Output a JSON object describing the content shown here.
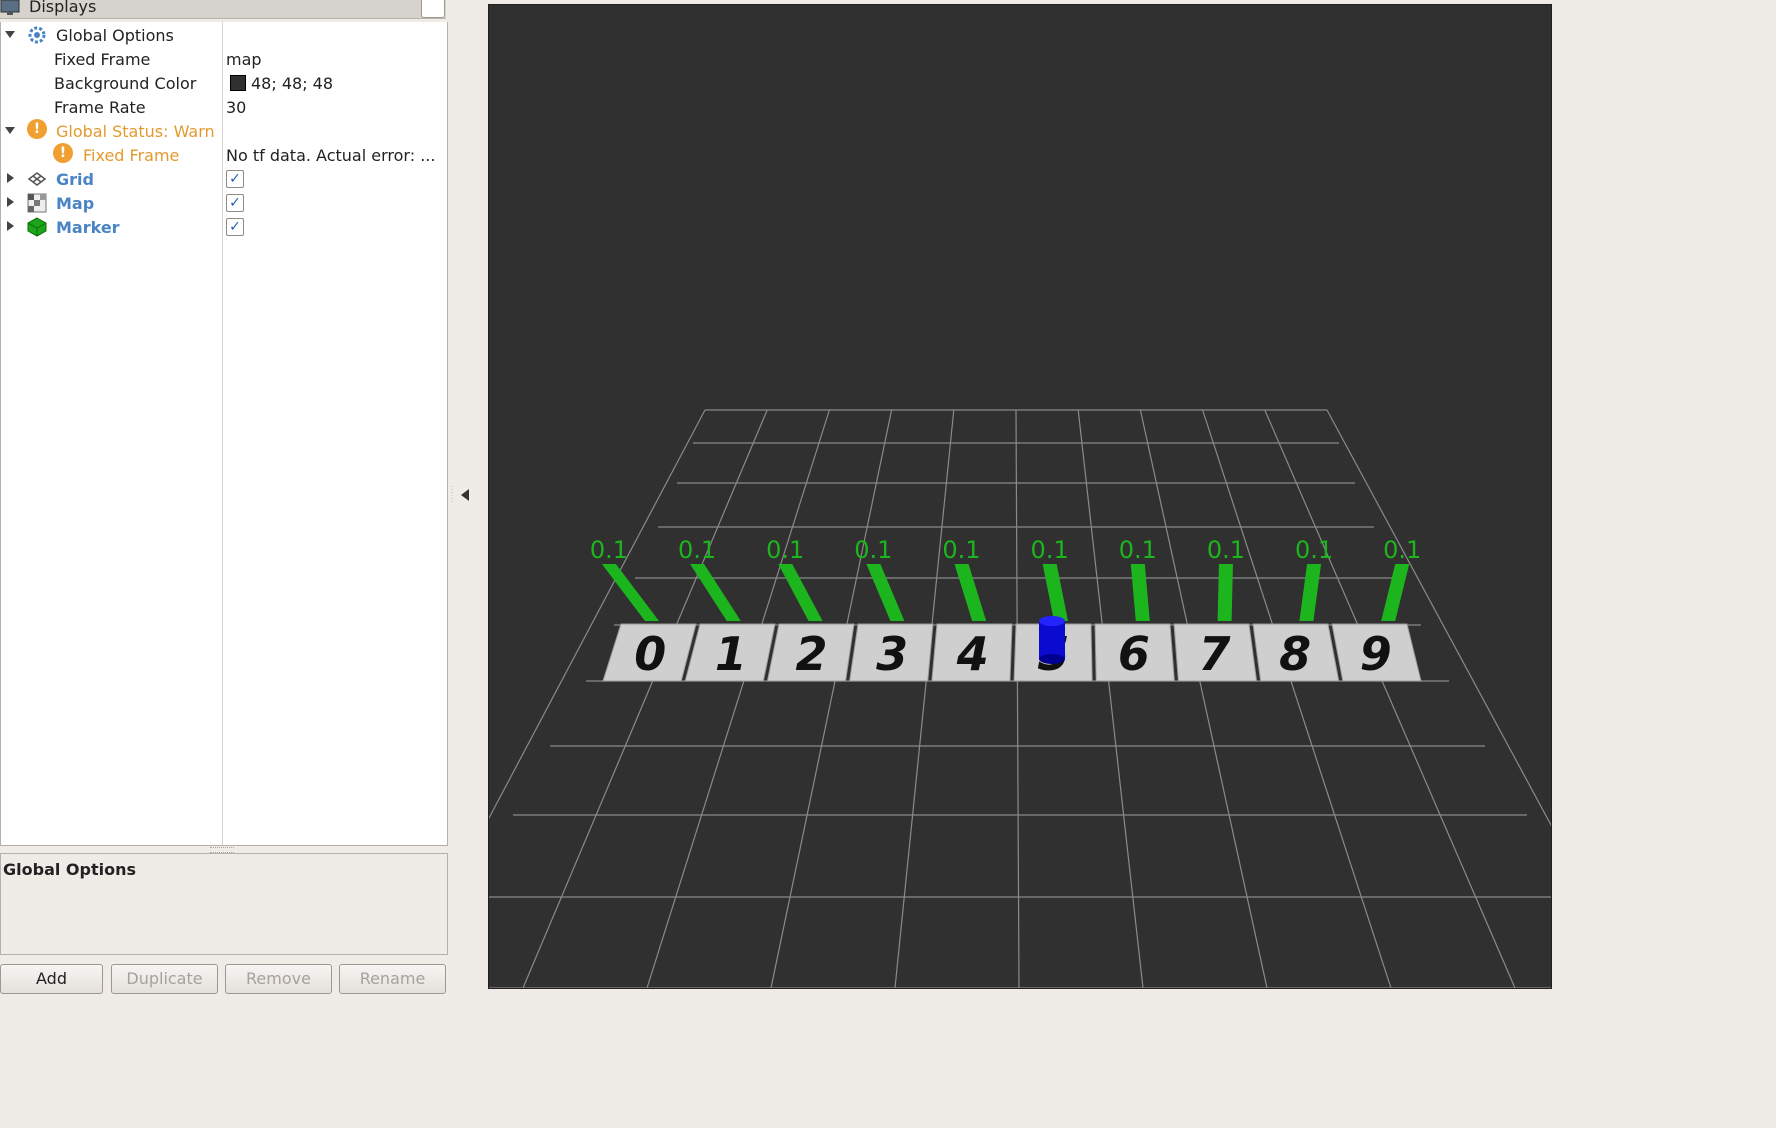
{
  "panel": {
    "title": "Displays",
    "tree": {
      "global_options": "Global Options",
      "fixed_frame_label": "Fixed Frame",
      "fixed_frame_value": "map",
      "background_color_label": "Background Color",
      "background_color_value": "48; 48; 48",
      "frame_rate_label": "Frame Rate",
      "frame_rate_value": "30",
      "global_status": "Global Status: Warn",
      "status_fixed_frame_label": "Fixed Frame",
      "status_fixed_frame_value": "No tf data.  Actual error: ...",
      "grid": "Grid",
      "map": "Map",
      "marker": "Marker"
    },
    "description_title": "Global Options",
    "buttons": {
      "add": "Add",
      "duplicate": "Duplicate",
      "remove": "Remove",
      "rename": "Rename"
    }
  },
  "view": {
    "background": "#303030",
    "tile_digits": [
      "0",
      "1",
      "2",
      "3",
      "4",
      "5",
      "6",
      "7",
      "8",
      "9"
    ],
    "marker_labels": [
      "0.1",
      "0.1",
      "0.1",
      "0.1",
      "0.1",
      "0.1",
      "0.1",
      "0.1",
      "0.1",
      "0.1"
    ],
    "marker_color": "#1db51d",
    "robot_color": "#0a0ad0"
  }
}
